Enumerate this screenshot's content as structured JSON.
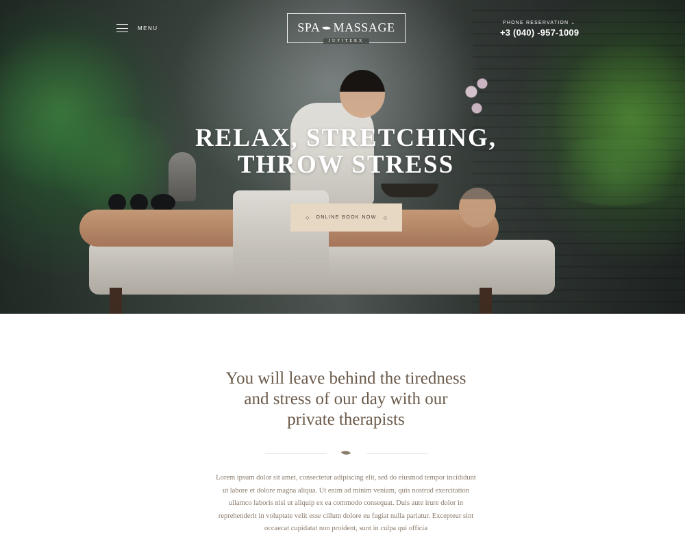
{
  "header": {
    "menu_label": "MENU",
    "logo": {
      "left": "SPA",
      "right": "MASSAGE",
      "sub": "JUPITERX"
    },
    "phone": {
      "label": "PHONE RESERVATION",
      "number": "+3 (040) -957-1009"
    }
  },
  "hero": {
    "title_lines": [
      "RELAX, STRETCHING,",
      "THROW STRESS"
    ],
    "cta_label": "ONLINE BOOK NOW"
  },
  "intro": {
    "heading_lines": [
      "You will leave behind the tiredness",
      "and stress of our day with our",
      "private therapists"
    ],
    "body": "Lorem ipsum dolor sit amet, consectetur adipiscing elit, sed do eiusmod tempor incididunt ut labore et dolore magna aliqua. Ut enim ad minim veniam, quis nostrud exercitation ullamco laboris nisi ut aliquip ex ea commodo consequat. Duis aute irure dolor in reprehenderit in voluptate velit esse cillum dolore eu fugiat nulla pariatur. Excepteur sint occaecat cupidatat non proident, sunt in culpa qui officia"
  },
  "icons": {
    "menu": "hamburger-icon",
    "logo_mark": "leaf-icon",
    "phone_chevron": "chevron-down-icon",
    "cta_ornament": "diamond-icon",
    "divider_mark": "leaf-icon"
  },
  "colors": {
    "cta_background": "#e6d8c3",
    "heading_text": "#6b5a4a",
    "body_text": "#8a7a6a"
  }
}
